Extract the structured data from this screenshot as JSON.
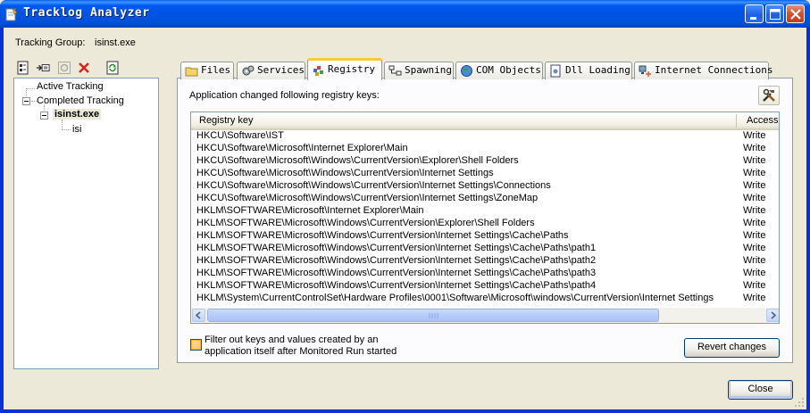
{
  "window": {
    "title": "Tracklog Analyzer",
    "icons": {
      "app": "tracklog-app-icon",
      "minimize": "minimize-icon",
      "maximize": "maximize-icon",
      "close": "close-icon"
    }
  },
  "tracking_group": {
    "label": "Tracking Group:",
    "value": "isinst.exe"
  },
  "toolbar": {
    "icons": [
      "new-tracking-icon",
      "run-monitored-icon",
      "stop-icon",
      "delete-icon",
      "refresh-icon"
    ]
  },
  "tree": {
    "items": [
      {
        "label": "Active Tracking"
      },
      {
        "label": "Completed Tracking"
      },
      {
        "label": "isinst.exe"
      },
      {
        "label": "isi"
      }
    ]
  },
  "tabs": [
    {
      "label": "Files",
      "icon": "folder-icon"
    },
    {
      "label": "Services",
      "icon": "gears-icon"
    },
    {
      "label": "Registry",
      "icon": "registry-icon"
    },
    {
      "label": "Spawning",
      "icon": "network-tree-icon"
    },
    {
      "label": "COM Objects",
      "icon": "globe-icon"
    },
    {
      "label": "Dll Loading",
      "icon": "dll-file-icon"
    },
    {
      "label": "Internet Connections",
      "icon": "network-computer-icon"
    }
  ],
  "active_tab": "Registry",
  "registry": {
    "intro": "Application changed following registry keys:",
    "tool_icon": "tools-icon",
    "columns": [
      "Registry key",
      "Access"
    ],
    "rows": [
      {
        "key": "HKCU\\Software\\IST",
        "access": "Write"
      },
      {
        "key": "HKCU\\Software\\Microsoft\\Internet Explorer\\Main",
        "access": "Write"
      },
      {
        "key": "HKCU\\Software\\Microsoft\\Windows\\CurrentVersion\\Explorer\\Shell Folders",
        "access": "Write"
      },
      {
        "key": "HKCU\\Software\\Microsoft\\Windows\\CurrentVersion\\Internet Settings",
        "access": "Write"
      },
      {
        "key": "HKCU\\Software\\Microsoft\\Windows\\CurrentVersion\\Internet Settings\\Connections",
        "access": "Write"
      },
      {
        "key": "HKCU\\Software\\Microsoft\\Windows\\CurrentVersion\\Internet Settings\\ZoneMap",
        "access": "Write"
      },
      {
        "key": "HKLM\\SOFTWARE\\Microsoft\\Internet Explorer\\Main",
        "access": "Write"
      },
      {
        "key": "HKLM\\SOFTWARE\\Microsoft\\Windows\\CurrentVersion\\Explorer\\Shell Folders",
        "access": "Write"
      },
      {
        "key": "HKLM\\SOFTWARE\\Microsoft\\Windows\\CurrentVersion\\Internet Settings\\Cache\\Paths",
        "access": "Write"
      },
      {
        "key": "HKLM\\SOFTWARE\\Microsoft\\Windows\\CurrentVersion\\Internet Settings\\Cache\\Paths\\path1",
        "access": "Write"
      },
      {
        "key": "HKLM\\SOFTWARE\\Microsoft\\Windows\\CurrentVersion\\Internet Settings\\Cache\\Paths\\path2",
        "access": "Write"
      },
      {
        "key": "HKLM\\SOFTWARE\\Microsoft\\Windows\\CurrentVersion\\Internet Settings\\Cache\\Paths\\path3",
        "access": "Write"
      },
      {
        "key": "HKLM\\SOFTWARE\\Microsoft\\Windows\\CurrentVersion\\Internet Settings\\Cache\\Paths\\path4",
        "access": "Write"
      },
      {
        "key": "HKLM\\System\\CurrentControlSet\\Hardware Profiles\\0001\\Software\\Microsoft\\windows\\CurrentVersion\\Internet Settings",
        "access": "Write"
      }
    ],
    "filter_checkbox": {
      "line1": "Filter out keys and values created by an",
      "line2": "application itself after Monitored Run started",
      "checked": false
    },
    "revert_button": "Revert changes"
  },
  "close_button": "Close",
  "colors": {
    "titlebar": "#0054e3",
    "dialog": "#ece9d8",
    "tab_highlight": "#ffc83c"
  }
}
